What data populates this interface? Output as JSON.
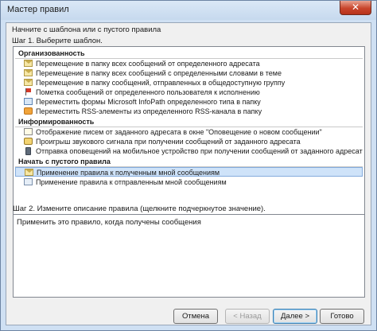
{
  "window": {
    "title": "Мастер правил",
    "close_glyph": "✕"
  },
  "intro": "Начните с шаблона или с пустого правила",
  "step1_label": "Шаг 1. Выберите шаблон.",
  "groups": {
    "organized": {
      "header": "Организованность",
      "items": [
        {
          "label": "Перемещение в папку всех сообщений от определенного адресата",
          "icon": "envelope-icon"
        },
        {
          "label": "Перемещение в папку всех сообщений с определенными словами в теме",
          "icon": "envelope-icon"
        },
        {
          "label": "Перемещение в папку сообщений, отправленных в общедоступную группу",
          "icon": "envelope-icon"
        },
        {
          "label": "Пометка сообщений от определенного пользователя к исполнению",
          "icon": "flag-icon"
        },
        {
          "label": "Переместить формы Microsoft InfoPath определенного типа в папку",
          "icon": "form-icon"
        },
        {
          "label": "Переместить RSS-элементы из определенного RSS-канала в папку",
          "icon": "rss-icon"
        }
      ]
    },
    "informed": {
      "header": "Информированность",
      "items": [
        {
          "label": "Отображение писем от заданного адресата в окне \"Оповещение о новом сообщении\"",
          "icon": "alert-window-icon"
        },
        {
          "label": "Проигрыш звукового сигнала при получении сообщений от заданного адресата",
          "icon": "sound-icon"
        },
        {
          "label": "Отправка оповещений на мобильное устройство при получении сообщений от заданного адресата",
          "icon": "mobile-icon"
        }
      ]
    },
    "blank": {
      "header": "Начать с пустого правила",
      "items": [
        {
          "label": "Применение правила к полученным мной сообщениям",
          "icon": "envelope-icon",
          "selected": true
        },
        {
          "label": "Применение правила к отправленным мной сообщениям",
          "icon": "send-icon"
        }
      ]
    }
  },
  "step2_label": "Шаг 2. Измените описание правила (щелкните подчеркнутое значение).",
  "description": "Применить это правило, когда получены сообщения",
  "buttons": {
    "cancel": "Отмена",
    "back": "< Назад",
    "next": "Далее >",
    "finish": "Готово"
  },
  "colors": {
    "selection": "#cfe3f9",
    "frame": "#cfe0f3",
    "close_button": "#c8452c"
  }
}
